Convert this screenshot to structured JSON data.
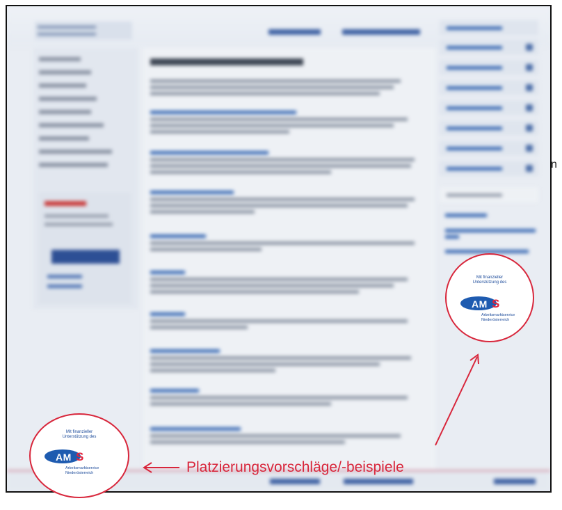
{
  "stray_text": "n",
  "caption": "Platzierungsvorschläge/-beispiele",
  "seal": {
    "line1": "Mit finanzieller",
    "line2": "Unterstützung des",
    "logo_am": "AM",
    "logo_s": "S",
    "sub1": "Arbeitsmarktservice",
    "sub2": "Niederösterreich"
  },
  "colors": {
    "annotation_red": "#d8263b",
    "ams_blue": "#1e5bb0"
  },
  "icons": {
    "arrow_left": "left-arrow",
    "arrow_up": "up-right-arrow"
  }
}
